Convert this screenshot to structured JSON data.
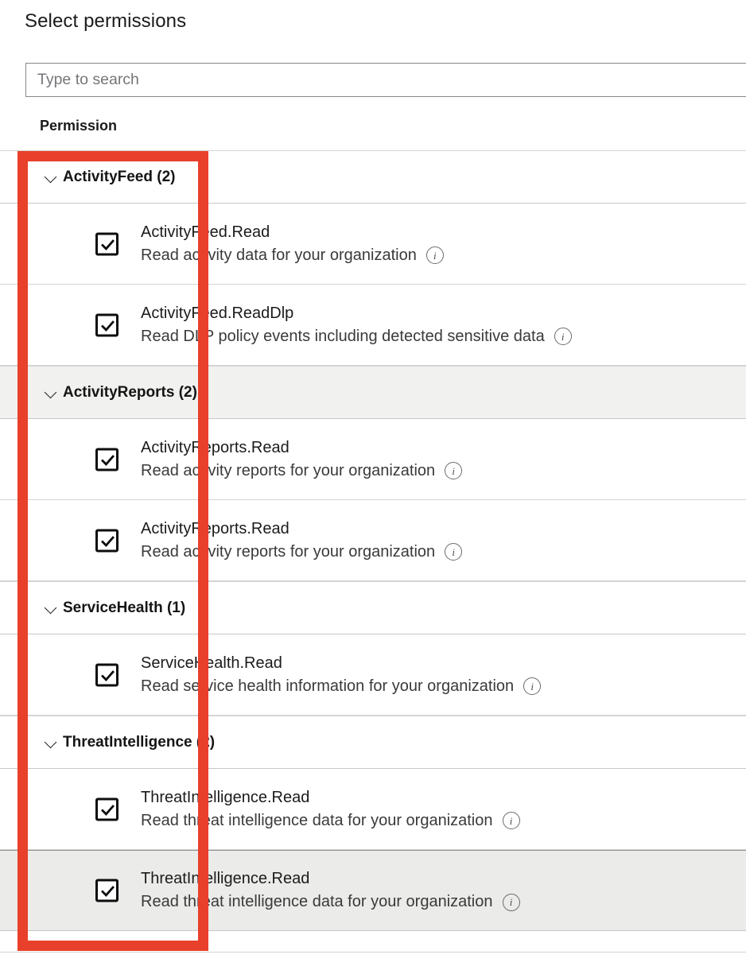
{
  "panel": {
    "title": "Select permissions"
  },
  "search": {
    "placeholder": "Type to search",
    "value": ""
  },
  "table": {
    "column_header": "Permission"
  },
  "icons": {
    "chevron": "chevron-down-icon",
    "info": "i",
    "checkmark": "check-icon"
  },
  "annotation": {
    "color": "#e8402a",
    "shape": "rectangle",
    "stroke_width": 13
  },
  "groups": [
    {
      "label": "ActivityFeed (2)",
      "name": "ActivityFeed",
      "count": 2,
      "expanded": true,
      "shaded": false,
      "items": [
        {
          "name": "ActivityFeed.Read",
          "description": "Read activity data for your organization",
          "checked": true,
          "selected": false
        },
        {
          "name": "ActivityFeed.ReadDlp",
          "description": "Read DLP policy events including detected sensitive data",
          "checked": true,
          "selected": false
        }
      ]
    },
    {
      "label": "ActivityReports (2)",
      "name": "ActivityReports",
      "count": 2,
      "expanded": true,
      "shaded": true,
      "items": [
        {
          "name": "ActivityReports.Read",
          "description": "Read activity reports for your organization",
          "checked": true,
          "selected": false
        },
        {
          "name": "ActivityReports.Read",
          "description": "Read activity reports for your organization",
          "checked": true,
          "selected": false
        }
      ]
    },
    {
      "label": "ServiceHealth (1)",
      "name": "ServiceHealth",
      "count": 1,
      "expanded": true,
      "shaded": false,
      "items": [
        {
          "name": "ServiceHealth.Read",
          "description": "Read service health information for your organization",
          "checked": true,
          "selected": false
        }
      ]
    },
    {
      "label": "ThreatIntelligence (2)",
      "name": "ThreatIntelligence",
      "count": 2,
      "expanded": true,
      "shaded": false,
      "items": [
        {
          "name": "ThreatIntelligence.Read",
          "description": "Read threat intelligence data for your organization",
          "checked": true,
          "selected": false
        },
        {
          "name": "ThreatIntelligence.Read",
          "description": "Read threat intelligence data for your organization",
          "checked": true,
          "selected": true
        }
      ]
    }
  ]
}
